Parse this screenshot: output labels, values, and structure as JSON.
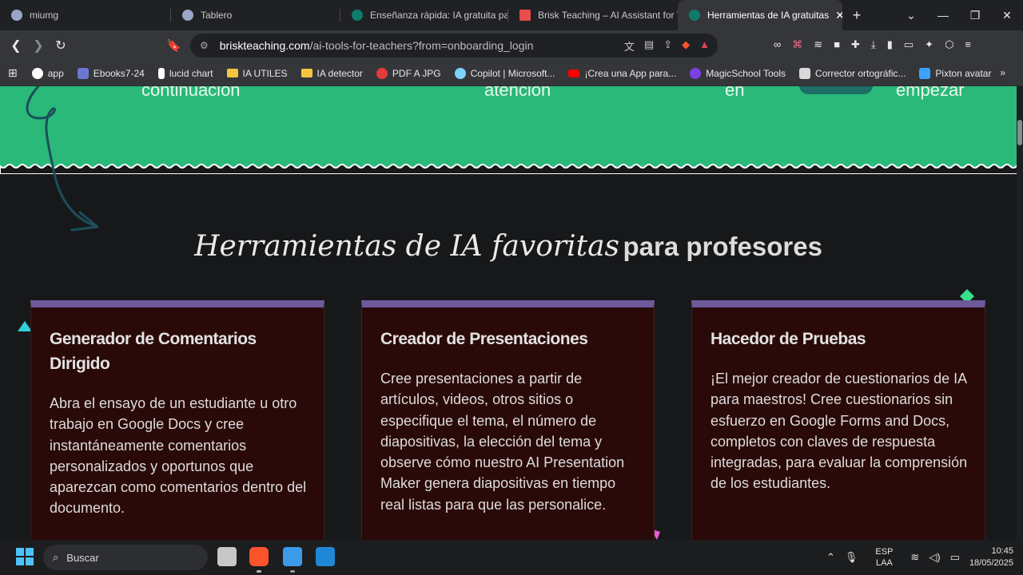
{
  "browser": {
    "tabs": [
      {
        "title": "miumg",
        "color": "#9aa6c7"
      },
      {
        "title": "Tablero",
        "color": "#9aa6c7"
      },
      {
        "title": "Enseñanza rápida: IA gratuita par",
        "color": "#0f7b6c"
      },
      {
        "title": "Brisk Teaching – AI Assistant for T",
        "color": "#e94d4d"
      },
      {
        "title": "Herramientas de IA gratuitas",
        "color": "#0f7b6c"
      }
    ],
    "new_tab": "+",
    "url_host": "briskteaching.com",
    "url_path": "/ai-tools-for-teachers?from=onboarding_login",
    "bookmarks": [
      {
        "label": "app",
        "icon": "google-icon",
        "color": "#ffffff"
      },
      {
        "label": "Ebooks7-24",
        "icon": "ebook-icon",
        "color": "#6a78d1"
      },
      {
        "label": "lucid chart",
        "icon": "lucid-icon",
        "color": "#ffffff"
      },
      {
        "label": "IA UTILES",
        "icon": "folder-icon",
        "color": "#f5c542"
      },
      {
        "label": "IA detector",
        "icon": "folder-icon",
        "color": "#f5c542"
      },
      {
        "label": "PDF A JPG",
        "icon": "heart-icon",
        "color": "#e33b3b"
      },
      {
        "label": "Copilot | Microsoft...",
        "icon": "copilot-icon",
        "color": "#7dd3fc"
      },
      {
        "label": "¡Crea una App para...",
        "icon": "youtube-icon",
        "color": "#ff0000"
      },
      {
        "label": "MagicSchool Tools",
        "icon": "magicschool-icon",
        "color": "#7b3fe4"
      },
      {
        "label": "Corrector ortográfic...",
        "icon": "spellcheck-icon",
        "color": "#d9d9d9"
      },
      {
        "label": "Pixton avatar",
        "icon": "pixton-icon",
        "color": "#3ba3ff"
      }
    ]
  },
  "page": {
    "banner_texts": [
      "continuación",
      "atención",
      "en",
      "empezar"
    ],
    "heading_italic": "Herramientas de IA favoritas",
    "heading_bold": "para profesores",
    "cards": [
      {
        "title": "Generador de Comentarios Dirigido",
        "desc": "Abra el ensayo de un estudiante u otro trabajo en Google Docs y cree instantáneamente comentarios personalizados y oportunos que aparezcan como comentarios dentro del documento."
      },
      {
        "title": "Creador de Presentaciones",
        "desc": "Cree presentaciones a partir de artículos, videos, otros sitios o especifique el tema, el número de diapositivas, la elección del tema y observe cómo nuestro AI Presentation Maker genera diapositivas en tiempo real listas para que las personalice."
      },
      {
        "title": "Hacedor de Pruebas",
        "desc": "¡El mejor creador de cuestionarios de IA para maestros! Cree cuestionarios sin esfuerzo en Google Forms and Docs, completos con claves de respuesta integradas, para evaluar la comprensión de los estudiantes."
      }
    ]
  },
  "taskbar": {
    "search_placeholder": "Buscar",
    "lang_line1": "ESP",
    "lang_line2": "LAA",
    "time": "10:45",
    "date": "18/05/2025"
  }
}
